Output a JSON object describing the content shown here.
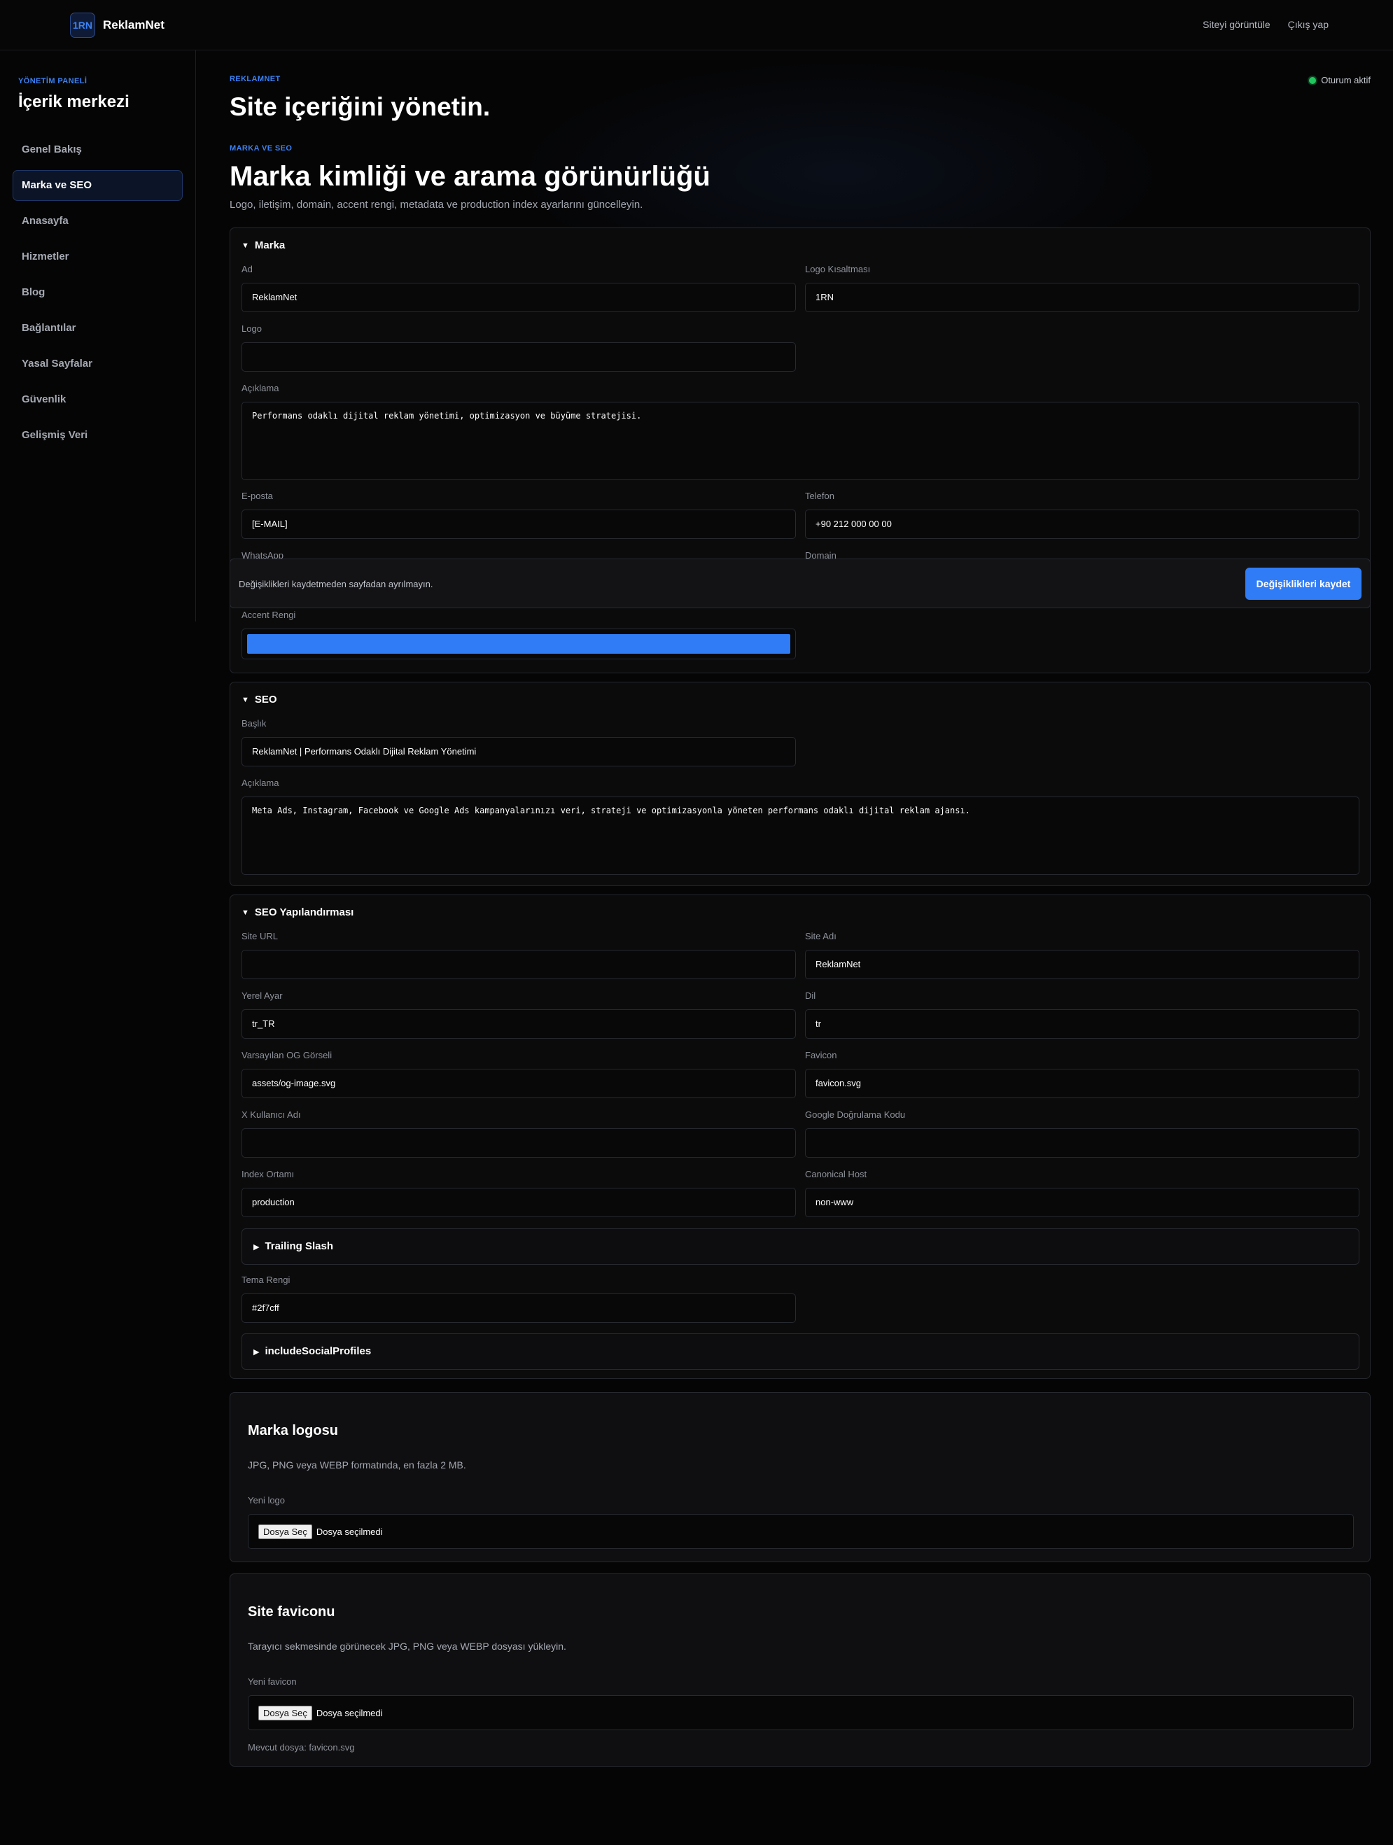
{
  "brand": {
    "mark": "1RN",
    "name": "ReklamNet"
  },
  "top_links": {
    "view_site": "Siteyi görüntüle",
    "logout": "Çıkış yap"
  },
  "sidebar": {
    "kicker": "YÖNETİM PANELİ",
    "title": "İçerik merkezi",
    "items": [
      {
        "label": "Genel Bakış"
      },
      {
        "label": "Marka ve SEO"
      },
      {
        "label": "Anasayfa"
      },
      {
        "label": "Hizmetler"
      },
      {
        "label": "Blog"
      },
      {
        "label": "Bağlantılar"
      },
      {
        "label": "Yasal Sayfalar"
      },
      {
        "label": "Güvenlik"
      },
      {
        "label": "Gelişmiş Veri"
      }
    ],
    "active_index": 1
  },
  "header": {
    "kicker": "REKLAMNET",
    "title": "Site içeriğini yönetin.",
    "session": "Oturum aktif"
  },
  "section": {
    "kicker": "MARKA VE SEO",
    "title": "Marka kimliği ve arama görünürlüğü",
    "desc": "Logo, iletişim, domain, accent rengi, metadata ve production index ayarlarını güncelleyin."
  },
  "marka": {
    "heading": "Marka",
    "ad_label": "Ad",
    "ad_value": "ReklamNet",
    "kisaltma_label": "Logo Kısaltması",
    "kisaltma_value": "1RN",
    "logo_label": "Logo",
    "logo_value": "",
    "aciklama_label": "Açıklama",
    "aciklama_value": "Performans odaklı dijital reklam yönetimi, optimizasyon ve büyüme stratejisi.",
    "eposta_label": "E-posta",
    "eposta_value": "[E-MAIL]",
    "telefon_label": "Telefon",
    "telefon_value": "+90 212 000 00 00",
    "whatsapp_label": "WhatsApp",
    "domain_label": "Domain",
    "accent_label": "Accent Rengi",
    "accent_color": "#2f7cf6"
  },
  "savebar": {
    "text": "Değişiklikleri kaydetmeden sayfadan ayrılmayın.",
    "button": "Değişiklikleri kaydet"
  },
  "seo": {
    "heading": "SEO",
    "baslik_label": "Başlık",
    "baslik_value": "ReklamNet | Performans Odaklı Dijital Reklam Yönetimi",
    "aciklama_label": "Açıklama",
    "aciklama_value": "Meta Ads, Instagram, Facebook ve Google Ads kampanyalarınızı veri, strateji ve optimizasyonla yöneten performans odaklı dijital reklam ajansı."
  },
  "seo_config": {
    "heading": "SEO Yapılandırması",
    "site_url_label": "Site URL",
    "site_url_value": "",
    "site_adi_label": "Site Adı",
    "site_adi_value": "ReklamNet",
    "yerel_label": "Yerel Ayar",
    "yerel_value": "tr_TR",
    "dil_label": "Dil",
    "dil_value": "tr",
    "og_label": "Varsayılan OG Görseli",
    "og_value": "assets/og-image.svg",
    "favicon_label": "Favicon",
    "favicon_value": "favicon.svg",
    "x_label": "X Kullanıcı Adı",
    "x_value": "",
    "google_label": "Google Doğrulama Kodu",
    "google_value": "",
    "index_label": "Index Ortamı",
    "index_value": "production",
    "canonical_label": "Canonical Host",
    "canonical_value": "non-www",
    "trailing_slash": "Trailing Slash",
    "tema_label": "Tema Rengi",
    "tema_value": "#2f7cff",
    "social_profiles": "includeSocialProfiles"
  },
  "logo_card": {
    "title": "Marka logosu",
    "desc": "JPG, PNG veya WEBP formatında, en fazla 2 MB.",
    "label": "Yeni logo",
    "button": "Dosya Seç",
    "status": "Dosya seçilmedi"
  },
  "favicon_card": {
    "title": "Site faviconu",
    "desc": "Tarayıcı sekmesinde görünecek JPG, PNG veya WEBP dosyası yükleyin.",
    "label": "Yeni favicon",
    "button": "Dosya Seç",
    "status": "Dosya seçilmedi",
    "note": "Mevcut dosya: favicon.svg"
  }
}
